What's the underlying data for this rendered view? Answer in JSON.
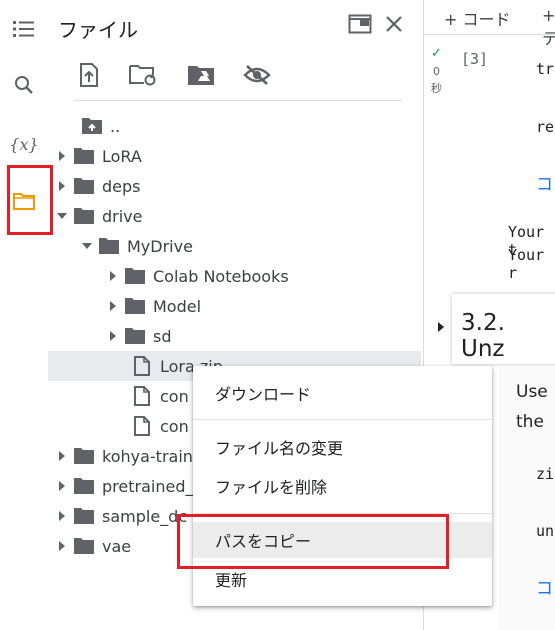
{
  "rail": {
    "icons": [
      "menu-list-icon",
      "search-icon",
      "variables-icon",
      "folder-icon"
    ],
    "variables_label": "{x}",
    "accent": "#f29900"
  },
  "file_panel": {
    "title": "ファイル",
    "toolbar": [
      "upload-icon",
      "refresh-folder-icon",
      "mount-drive-icon",
      "hide-files-icon"
    ],
    "tree": [
      {
        "label": "..",
        "type": "folder-up"
      },
      {
        "label": "LoRA",
        "type": "folder"
      },
      {
        "label": "deps",
        "type": "folder"
      },
      {
        "label": "drive",
        "type": "folder",
        "expanded": true
      },
      {
        "label": "MyDrive",
        "type": "folder",
        "expanded": true
      },
      {
        "label": "Colab Notebooks",
        "type": "folder"
      },
      {
        "label": "Model",
        "type": "folder"
      },
      {
        "label": "sd",
        "type": "folder"
      },
      {
        "label": "Lora.zip",
        "type": "file",
        "selected": true
      },
      {
        "label": "con",
        "type": "file"
      },
      {
        "label": "con",
        "type": "file"
      },
      {
        "label": "kohya-train",
        "type": "folder"
      },
      {
        "label": "pretrained_",
        "type": "folder"
      },
      {
        "label": "sample_dc",
        "type": "folder"
      },
      {
        "label": "vae",
        "type": "folder"
      }
    ]
  },
  "context_menu": {
    "items": [
      "ダウンロード",
      "ファイル名の変更",
      "ファイルを削除",
      "パスをコピー",
      "更新"
    ],
    "active_index": 3
  },
  "notebook": {
    "add_code_label": "+ コード",
    "add_text_label": "+ テ",
    "run_check": "✓",
    "run_time_num": "0",
    "run_time_unit": "秒",
    "cell_index": "[3]",
    "code": [
      "tr",
      "re"
    ],
    "link_1": "コ",
    "output": [
      "Your t",
      "Your r"
    ],
    "section_heading": "3.2. Unz",
    "para": [
      "Use",
      "the"
    ],
    "code2": [
      "zi",
      "un"
    ],
    "link_2": "コ"
  },
  "highlight_color": "#e01f28"
}
